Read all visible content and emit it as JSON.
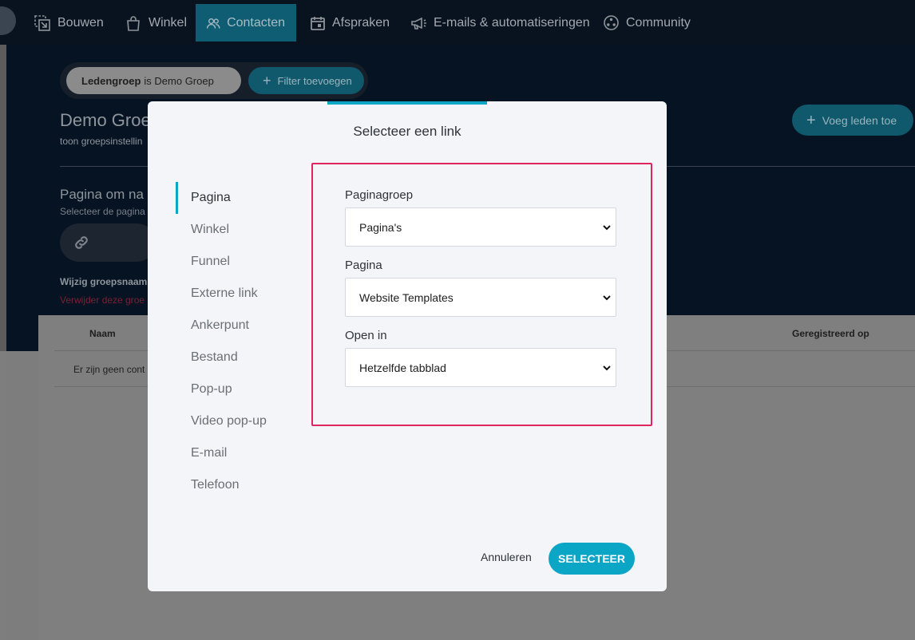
{
  "nav": {
    "items": [
      {
        "label": "Bouwen",
        "icon": "build-icon"
      },
      {
        "label": "Winkel",
        "icon": "shopping-bag-icon"
      },
      {
        "label": "Contacten",
        "icon": "contacts-icon",
        "active": true
      },
      {
        "label": "Afspraken",
        "icon": "calendar-icon"
      },
      {
        "label": "E-mails & automatiseringen",
        "icon": "megaphone-icon"
      },
      {
        "label": "Community",
        "icon": "community-icon"
      }
    ]
  },
  "filter": {
    "chip_key": "Ledengroep",
    "chip_value": "is Demo Groep",
    "add_label": "Filter toevoegen"
  },
  "group": {
    "title": "Demo Groe",
    "subtitle": "toon groepsinstellin",
    "add_members_label": "Voeg leden toe"
  },
  "page_section": {
    "title": "Pagina om na",
    "subtitle": "Selecteer de pagina",
    "rename_label": "Wijzig groepsnaam",
    "delete_label": "Verwijder deze groe"
  },
  "table": {
    "col_name": "Naam",
    "col_registered": "Geregistreerd op",
    "empty_text": "Er zijn geen cont"
  },
  "modal": {
    "title": "Selecteer een link",
    "tabs": [
      "Pagina",
      "Winkel",
      "Funnel",
      "Externe link",
      "Ankerpunt",
      "Bestand",
      "Pop-up",
      "Video pop-up",
      "E-mail",
      "Telefoon"
    ],
    "active_tab": "Pagina",
    "fields": {
      "page_group": {
        "label": "Paginagroep",
        "value": "Pagina's"
      },
      "page": {
        "label": "Pagina",
        "value": "Website Templates"
      },
      "open_in": {
        "label": "Open in",
        "value": "Hetzelfde tabblad"
      }
    },
    "cancel_label": "Annuleren",
    "select_label": "SELECTEER"
  },
  "colors": {
    "accent": "#0ba5c6",
    "highlight_border": "#e0245e",
    "nav_bg": "#08131f"
  }
}
